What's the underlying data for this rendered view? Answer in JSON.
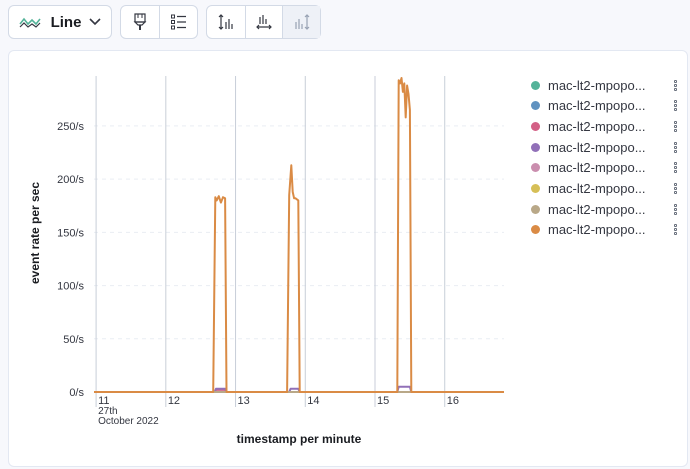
{
  "toolbar": {
    "chart_type_label": "Line",
    "colors": {
      "line_icon": "#54b399",
      "icon": "#343741",
      "icon_disabled": "#98a2b3"
    }
  },
  "chart_data": {
    "type": "line",
    "xlabel": "timestamp per minute",
    "ylabel": "event rate per sec",
    "ylim": [
      0,
      300
    ],
    "xlim": [
      10.97,
      16.85
    ],
    "y_ticks": [
      {
        "value": 0,
        "label": "0/s"
      },
      {
        "value": 50,
        "label": "50/s"
      },
      {
        "value": 100,
        "label": "100/s"
      },
      {
        "value": 150,
        "label": "150/s"
      },
      {
        "value": 200,
        "label": "200/s"
      },
      {
        "value": 250,
        "label": "250/s"
      }
    ],
    "x_ticks": [
      {
        "value": 11,
        "label": "11",
        "sub": [
          "27th",
          "October 2022"
        ]
      },
      {
        "value": 12,
        "label": "12"
      },
      {
        "value": 13,
        "label": "13"
      },
      {
        "value": 14,
        "label": "14"
      },
      {
        "value": 15,
        "label": "15"
      },
      {
        "value": 16,
        "label": "16"
      }
    ],
    "gaps": [
      [
        14.05,
        14.93
      ]
    ],
    "grid": true,
    "legend_position": "right",
    "series": [
      {
        "name": "mac-lt2-mpopo...",
        "color": "#54b399",
        "x": [
          10.97,
          16.85
        ],
        "y": [
          0,
          0
        ]
      },
      {
        "name": "mac-lt2-mpopo...",
        "color": "#6092c0",
        "x": [
          10.97,
          16.85
        ],
        "y": [
          0,
          0
        ]
      },
      {
        "name": "mac-lt2-mpopo...",
        "color": "#d36086",
        "x": [
          10.97,
          12.7,
          12.72,
          12.85,
          12.87,
          16.85
        ],
        "y": [
          0,
          0,
          2,
          2,
          0,
          0
        ]
      },
      {
        "name": "mac-lt2-mpopo...",
        "color": "#9170b8",
        "x": [
          10.97,
          12.7,
          12.72,
          12.85,
          12.87,
          13.77,
          13.79,
          13.9,
          13.92,
          15.32,
          15.34,
          15.5,
          15.52,
          16.85
        ],
        "y": [
          0,
          0,
          3,
          3,
          0,
          0,
          3,
          3,
          0,
          0,
          5,
          5,
          0,
          0
        ]
      },
      {
        "name": "mac-lt2-mpopo...",
        "color": "#ca8eae",
        "x": [
          10.97,
          16.85
        ],
        "y": [
          0,
          0
        ]
      },
      {
        "name": "mac-lt2-mpopo...",
        "color": "#d6bf57",
        "x": [
          10.97,
          16.85
        ],
        "y": [
          0,
          0
        ]
      },
      {
        "name": "mac-lt2-mpopo...",
        "color": "#b9a888",
        "x": [
          10.97,
          16.85
        ],
        "y": [
          0,
          0
        ]
      },
      {
        "name": "mac-lt2-mpopo...",
        "color": "#da8b45",
        "x": [
          10.97,
          12.68,
          12.71,
          12.73,
          12.76,
          12.79,
          12.82,
          12.85,
          12.87,
          13.74,
          13.77,
          13.8,
          13.82,
          13.84,
          13.86,
          13.9,
          13.92,
          15.32,
          15.34,
          15.36,
          15.38,
          15.4,
          15.42,
          15.44,
          15.46,
          15.48,
          15.5,
          15.52,
          16.85
        ],
        "y": [
          0,
          0,
          183,
          180,
          184,
          178,
          183,
          182,
          0,
          0,
          185,
          213,
          188,
          182,
          182,
          180,
          0,
          0,
          293,
          290,
          295,
          282,
          290,
          258,
          288,
          280,
          265,
          0,
          0
        ]
      }
    ]
  }
}
